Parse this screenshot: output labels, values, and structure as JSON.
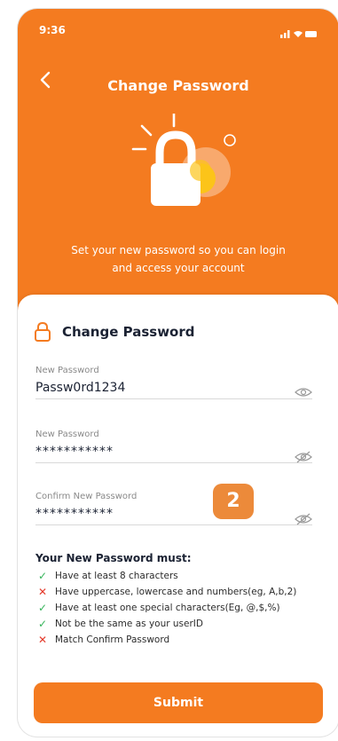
{
  "status": {
    "time": "9:36"
  },
  "header": {
    "title": "Change Password",
    "subtitle_line1": "Set your new password so you can login",
    "subtitle_line2": "and access your account"
  },
  "card": {
    "title": "Change Password"
  },
  "fields": [
    {
      "label": "New Password",
      "value": "Passw0rd1234"
    },
    {
      "label": "New Password",
      "value": "***********"
    },
    {
      "label": "Confirm New Password",
      "value": "***********"
    }
  ],
  "badge": "2",
  "rules": {
    "title": "Your New Password must:",
    "items": [
      {
        "text": "Have at least 8 characters",
        "mark": "✓",
        "status": "ok"
      },
      {
        "text": "Have uppercase, lowercase and numbers(eg, A,b,2)",
        "mark": "✕",
        "status": "fail"
      },
      {
        "text": "Have at least one special characters(Eg, @,$,%)",
        "mark": "✓",
        "status": "ok"
      },
      {
        "text": "Not be the same as your userID",
        "mark": "✓",
        "status": "ok"
      },
      {
        "text": "Match Confirm Password",
        "mark": "✕",
        "status": "fail"
      }
    ]
  },
  "submit_label": "Submit",
  "colors": {
    "accent": "#f47b20",
    "ok": "#35b45a",
    "fail": "#e43a2b",
    "badge": "#ec8a3a"
  }
}
